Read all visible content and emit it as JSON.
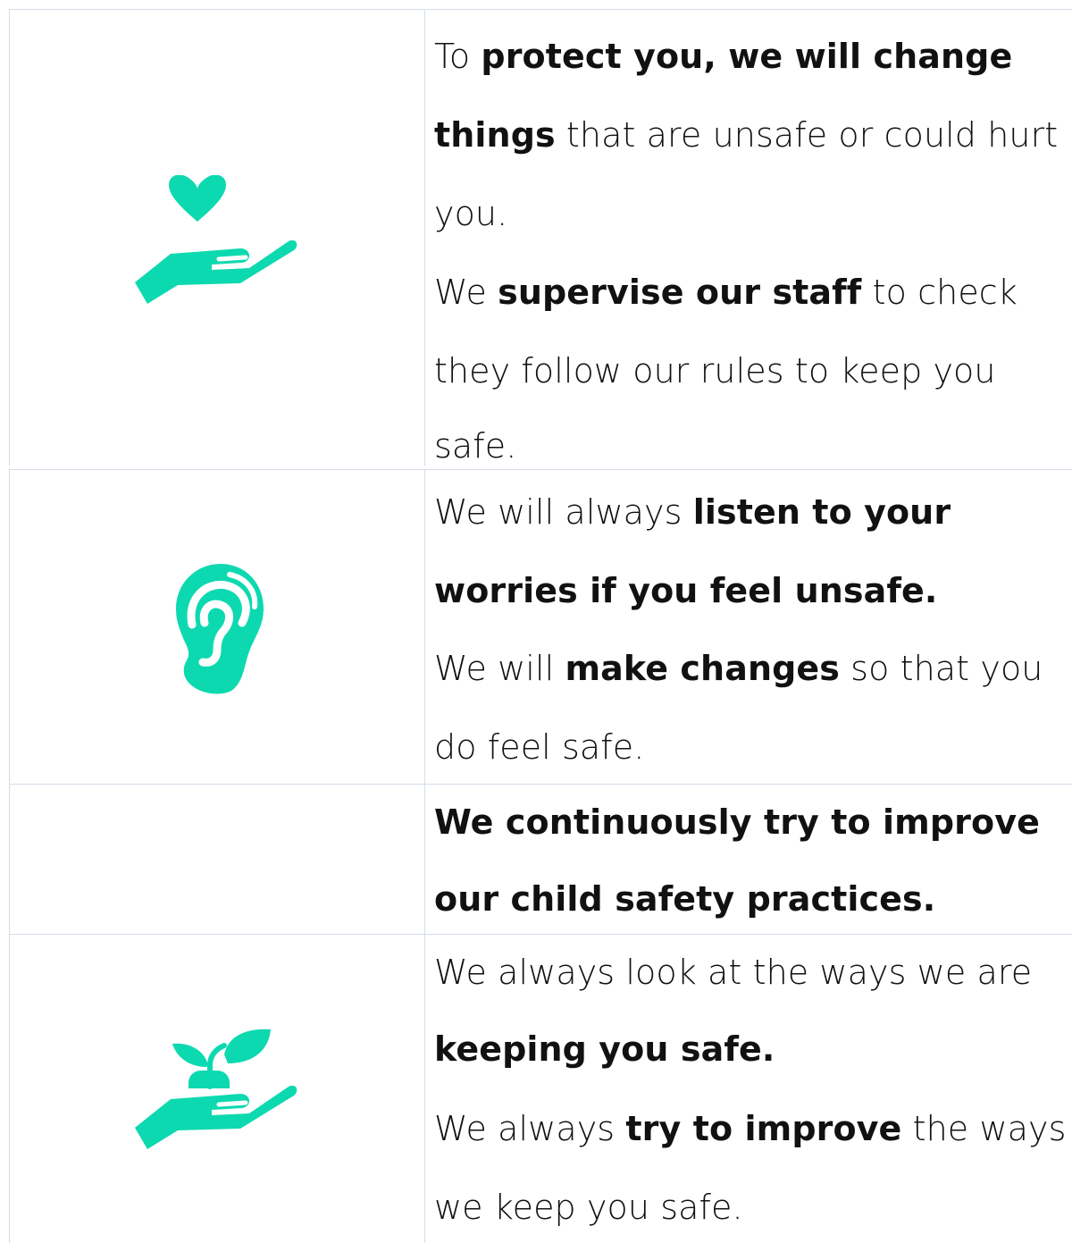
{
  "colors": {
    "accent": "#0dd9b0",
    "grid": "#d3dde8",
    "text": "#111111"
  },
  "rows": [
    {
      "icon": "hand-heart-icon",
      "lines": [
        [
          "To ",
          "protect you, we will change"
        ],
        [
          "things",
          " that are unsafe or could hurt"
        ],
        [
          "you."
        ],
        [
          "We ",
          "supervise our staff",
          " to check"
        ],
        [
          "they follow our rules to keep you"
        ],
        [
          "safe."
        ]
      ]
    },
    {
      "icon": "ear-icon",
      "lines": [
        [
          "We will always ",
          "listen to your"
        ],
        [
          "",
          "worries if you feel unsafe."
        ],
        [
          "We will ",
          "make changes",
          " so that you"
        ],
        [
          "do feel safe."
        ]
      ]
    },
    {
      "icon": "",
      "lines": [
        [
          "",
          "We continuously try to improve"
        ],
        [
          "",
          "our child safety practices."
        ]
      ]
    },
    {
      "icon": "hand-plant-icon",
      "lines": [
        [
          "We always look at the ways we are"
        ],
        [
          "",
          "keeping you safe."
        ],
        [
          "We always ",
          "try to improve",
          " the ways"
        ],
        [
          "we keep you safe."
        ]
      ]
    }
  ]
}
